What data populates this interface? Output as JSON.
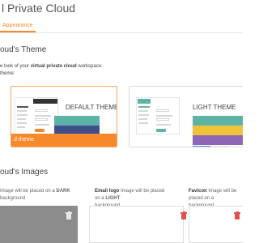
{
  "page": {
    "title": "l Private Cloud"
  },
  "tabs": [
    {
      "label": "Appearance",
      "active": true
    }
  ],
  "theme_section": {
    "title": "oud's Theme",
    "desc_prefix": "e look of your ",
    "desc_bold": "virtual private cloud",
    "desc_suffix": " workspace.",
    "prompt": "theme:",
    "default_theme": {
      "name": "DEFAULT THEME",
      "selected_label": "d theme",
      "colors": {
        "accent": "#f5892b",
        "stripe_1": "#5cb3a6",
        "stripe_2": "#3f4f8e",
        "stripe_3": "#5a6faa"
      },
      "topbar_color": "#333333",
      "button_color": "#f5892b"
    },
    "light_theme": {
      "name": "LIGHT THEME",
      "colors": {
        "stripe_1": "#5cb3a6",
        "stripe_2": "#f0c23a",
        "stripe_3": "#8d66b8",
        "stripe_4": "#4a90d9"
      },
      "topbar_color": "#5cb3a6",
      "button_color": "#5cb3a6"
    }
  },
  "images_section": {
    "title": "oud's Images",
    "columns": [
      {
        "label": "",
        "desc_prefix": "Image will be placed on a ",
        "desc_caps": "DARK",
        "desc_suffix": " background",
        "box_color": "#8c8c8c"
      },
      {
        "label": "Email logo",
        "desc_prefix": "Image will be placed on a ",
        "desc_caps": "LIGHT",
        "desc_suffix": " background",
        "box_color": "#ffffff"
      },
      {
        "label": "Favicon",
        "desc_prefix": "Image will be placed on a",
        "desc_caps": "",
        "desc_suffix": " background",
        "box_color": "#ffffff"
      }
    ]
  },
  "icons": {
    "delete": "trash-icon"
  }
}
